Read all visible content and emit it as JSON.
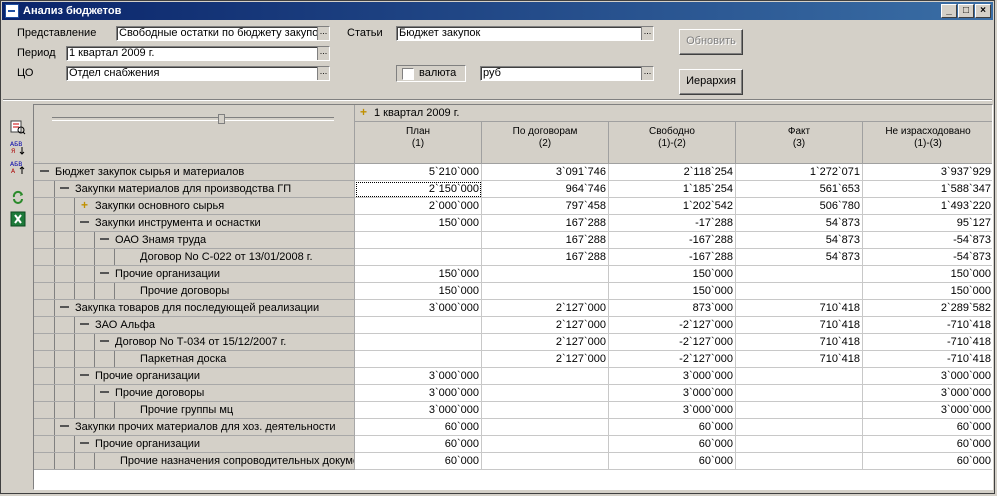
{
  "window": {
    "title": "Анализ бюджетов"
  },
  "filters": {
    "representation_label": "Представление",
    "representation_value": "Свободные остатки по бюджету закупо",
    "articles_label": "Статьи",
    "articles_value": "Бюджет закупок",
    "period_label": "Период",
    "period_value": "1 квартал 2009 г.",
    "co_label": "ЦО",
    "co_value": "Отдел снабжения",
    "currency_label": "валюта",
    "currency_value": "руб",
    "refresh_label": "Обновить",
    "hierarchy_label": "Иерархия"
  },
  "grid": {
    "period_header": "1 квартал 2009 г.",
    "columns": [
      {
        "l1": "План",
        "l2": "(1)"
      },
      {
        "l1": "По договорам",
        "l2": "(2)"
      },
      {
        "l1": "Свободно",
        "l2": "(1)-(2)"
      },
      {
        "l1": "Факт",
        "l2": "(3)"
      },
      {
        "l1": "Не израсходовано",
        "l2": "(1)-(3)"
      }
    ],
    "rows": [
      {
        "level": 0,
        "icon": "minus",
        "label": "Бюджет закупок сырья и материалов",
        "values": [
          "5`210`000",
          "3`091`746",
          "2`118`254",
          "1`272`071",
          "3`937`929"
        ]
      },
      {
        "level": 1,
        "icon": "minus",
        "label": "Закупки материалов для производства ГП",
        "values": [
          "2`150`000",
          "964`746",
          "1`185`254",
          "561`653",
          "1`588`347"
        ]
      },
      {
        "level": 2,
        "icon": "plus",
        "label": "Закупки основного сырья",
        "values": [
          "2`000`000",
          "797`458",
          "1`202`542",
          "506`780",
          "1`493`220"
        ]
      },
      {
        "level": 2,
        "icon": "minus",
        "label": "Закупки инструмента и оснастки",
        "values": [
          "150`000",
          "167`288",
          "-17`288",
          "54`873",
          "95`127"
        ]
      },
      {
        "level": 3,
        "icon": "minus",
        "label": "ОАО Знамя труда",
        "values": [
          "",
          "167`288",
          "-167`288",
          "54`873",
          "-54`873"
        ]
      },
      {
        "level": 4,
        "icon": "",
        "label": "Договор No С-022 от 13/01/2008 г.",
        "values": [
          "",
          "167`288",
          "-167`288",
          "54`873",
          "-54`873"
        ]
      },
      {
        "level": 3,
        "icon": "minus",
        "label": "Прочие организации",
        "values": [
          "150`000",
          "",
          "150`000",
          "",
          "150`000"
        ]
      },
      {
        "level": 4,
        "icon": "",
        "label": "Прочие договоры",
        "values": [
          "150`000",
          "",
          "150`000",
          "",
          "150`000"
        ]
      },
      {
        "level": 1,
        "icon": "minus",
        "label": "Закупка товаров для последующей реализации",
        "values": [
          "3`000`000",
          "2`127`000",
          "873`000",
          "710`418",
          "2`289`582"
        ]
      },
      {
        "level": 2,
        "icon": "minus",
        "label": "ЗАО Альфа",
        "values": [
          "",
          "2`127`000",
          "-2`127`000",
          "710`418",
          "-710`418"
        ]
      },
      {
        "level": 3,
        "icon": "minus",
        "label": "Договор No Т-034 от 15/12/2007 г.",
        "values": [
          "",
          "2`127`000",
          "-2`127`000",
          "710`418",
          "-710`418"
        ]
      },
      {
        "level": 4,
        "icon": "",
        "label": "Паркетная доска",
        "values": [
          "",
          "2`127`000",
          "-2`127`000",
          "710`418",
          "-710`418"
        ]
      },
      {
        "level": 2,
        "icon": "minus",
        "label": "Прочие организации",
        "values": [
          "3`000`000",
          "",
          "3`000`000",
          "",
          "3`000`000"
        ]
      },
      {
        "level": 3,
        "icon": "minus",
        "label": "Прочие договоры",
        "values": [
          "3`000`000",
          "",
          "3`000`000",
          "",
          "3`000`000"
        ]
      },
      {
        "level": 4,
        "icon": "",
        "label": "Прочие группы мц",
        "values": [
          "3`000`000",
          "",
          "3`000`000",
          "",
          "3`000`000"
        ]
      },
      {
        "level": 1,
        "icon": "minus",
        "label": "Закупки прочих материалов для хоз. деятельности",
        "values": [
          "60`000",
          "",
          "60`000",
          "",
          "60`000"
        ]
      },
      {
        "level": 2,
        "icon": "minus",
        "label": "Прочие организации",
        "values": [
          "60`000",
          "",
          "60`000",
          "",
          "60`000"
        ]
      },
      {
        "level": 3,
        "icon": "",
        "label": "Прочие назначения сопроводительных докуме",
        "values": [
          "60`000",
          "",
          "60`000",
          "",
          "60`000"
        ]
      }
    ]
  },
  "toolbar_icons": [
    "query-icon",
    "sort-asc-icon",
    "sort-desc-icon",
    "refresh-icon",
    "excel-icon"
  ]
}
